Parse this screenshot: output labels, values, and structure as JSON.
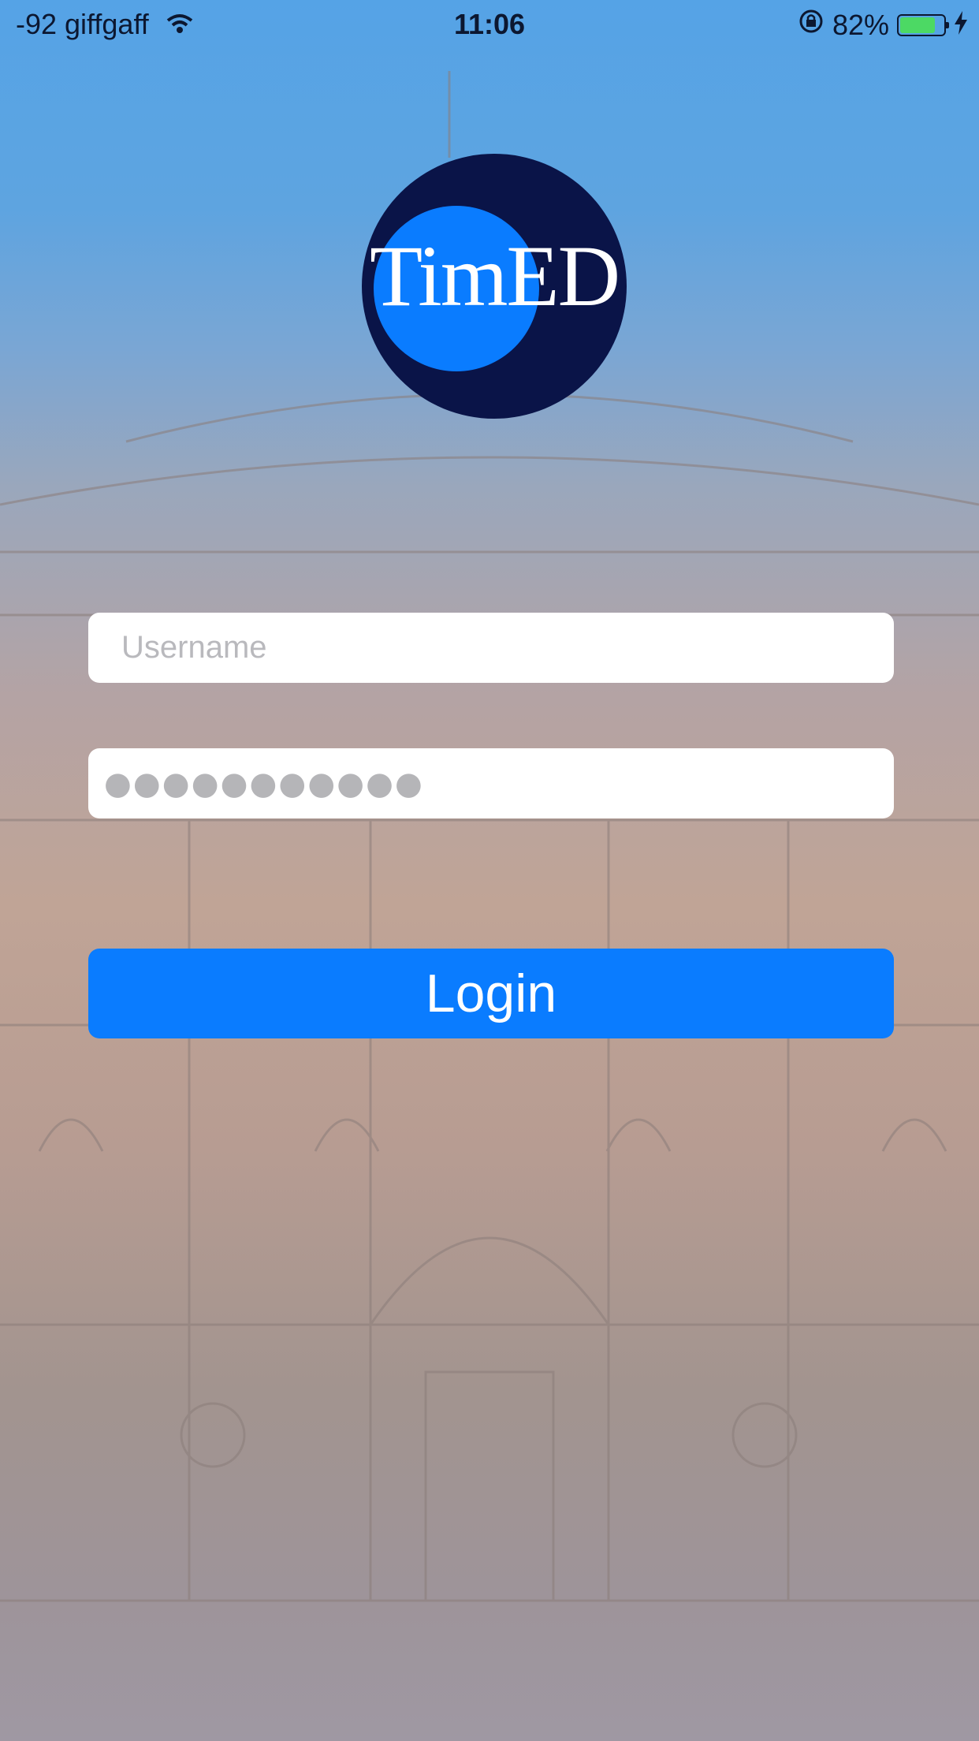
{
  "status_bar": {
    "carrier": "-92 giffgaff",
    "time": "11:06",
    "battery_percent": "82%",
    "icons": [
      "wifi-icon",
      "rotation-lock-icon",
      "battery-icon",
      "charging-bolt-icon"
    ]
  },
  "logo": {
    "text": "TimED"
  },
  "login_form": {
    "username_placeholder": "Username",
    "password_mask": "●●●●●●●●●●●",
    "login_label": "Login"
  },
  "colors": {
    "accent": "#0a7cff",
    "logo_dark": "#0a1448",
    "battery_green": "#4cd964"
  }
}
